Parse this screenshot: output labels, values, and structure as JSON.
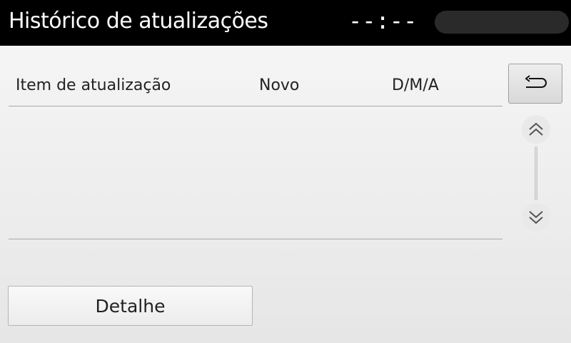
{
  "header": {
    "title": "Histórico de atualizações",
    "clock": "--:--"
  },
  "table": {
    "columns": [
      "Item de atualização",
      "Novo",
      "D/M/A"
    ],
    "rows": []
  },
  "buttons": {
    "back_icon": "back-arrow-icon",
    "scroll_up_icon": "double-chevron-up-icon",
    "scroll_down_icon": "double-chevron-down-icon",
    "detail_label": "Detalhe"
  }
}
